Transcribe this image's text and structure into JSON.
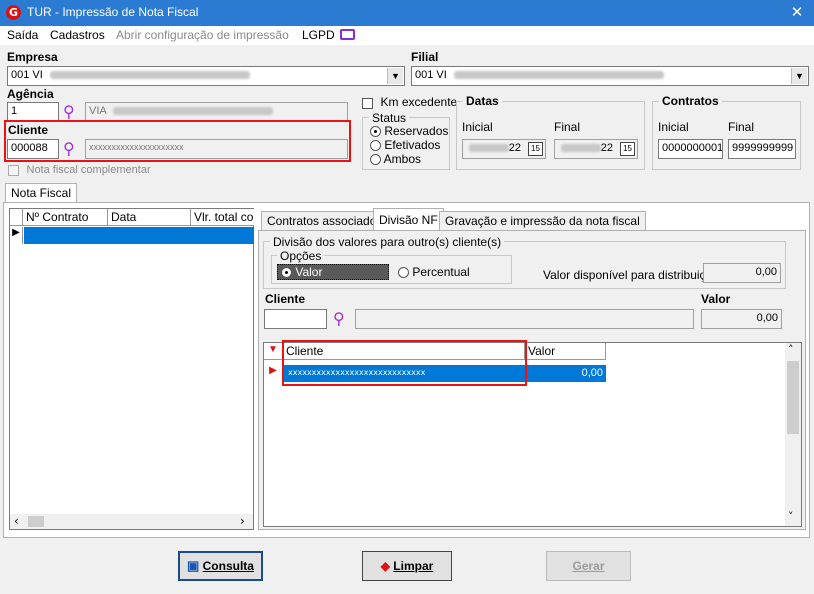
{
  "window": {
    "title": "TUR - Impressão de Nota Fiscal",
    "logo_letter": "G",
    "close_glyph": "✕"
  },
  "menu": {
    "items": [
      "Saída",
      "Cadastros",
      "Abrir configuração de impressão",
      "LGPD"
    ]
  },
  "empresa": {
    "label": "Empresa",
    "value": "001 VI"
  },
  "filial": {
    "label": "Filial",
    "value": "001 VI"
  },
  "agencia": {
    "label": "Agência",
    "code": "1",
    "name": "VIA"
  },
  "cliente": {
    "label": "Cliente",
    "code": "000088",
    "name": "xxxxxxxxxxxxxxxxxxxxx"
  },
  "nota_complementar": {
    "label": "Nota fiscal complementar"
  },
  "km_excedente": {
    "label": "Km excedente"
  },
  "status": {
    "title": "Status",
    "options": [
      "Reservados",
      "Efetivados",
      "Ambos"
    ],
    "selected": "Reservados"
  },
  "datas": {
    "title": "Datas",
    "inicial_label": "Inicial",
    "final_label": "Final",
    "inicial_suffix": "22",
    "final_suffix": "22",
    "cal_glyph": "15"
  },
  "contratos": {
    "title": "Contratos",
    "inicial_label": "Inicial",
    "final_label": "Final",
    "inicial": "0000000001",
    "final": "9999999999"
  },
  "left_tab": {
    "label": "Nota Fiscal"
  },
  "left_grid": {
    "columns": [
      "Nº Contrato",
      "Data",
      "Vlr. total cor"
    ]
  },
  "right_tabs": [
    "Contratos associados",
    "Divisão NF",
    "Gravação e impressão da nota fiscal"
  ],
  "divisao": {
    "group_title": "Divisão dos valores para outro(s) cliente(s)",
    "opcoes_title": "Opções",
    "opcoes": [
      "Valor",
      "Percentual"
    ],
    "selected": "Valor",
    "disponivel_label": "Valor disponível para distribuição",
    "disponivel_value": "0,00",
    "cliente_label": "Cliente",
    "valor_label": "Valor",
    "valor_value": "0,00"
  },
  "split_grid": {
    "columns": [
      "Cliente",
      "Valor"
    ],
    "rows": [
      {
        "cliente": "xxxxxxxxxxxxxxxxxxxxxxxxxxxxx",
        "valor": "0,00"
      }
    ]
  },
  "buttons": {
    "consulta": "Consulta",
    "limpar": "Limpar",
    "gerar": "Gerar"
  },
  "colors": {
    "title_bar": "#2b7bd3",
    "selection": "#0078d7",
    "highlight_box": "#e11111",
    "search_icon": "#a12fd6"
  }
}
